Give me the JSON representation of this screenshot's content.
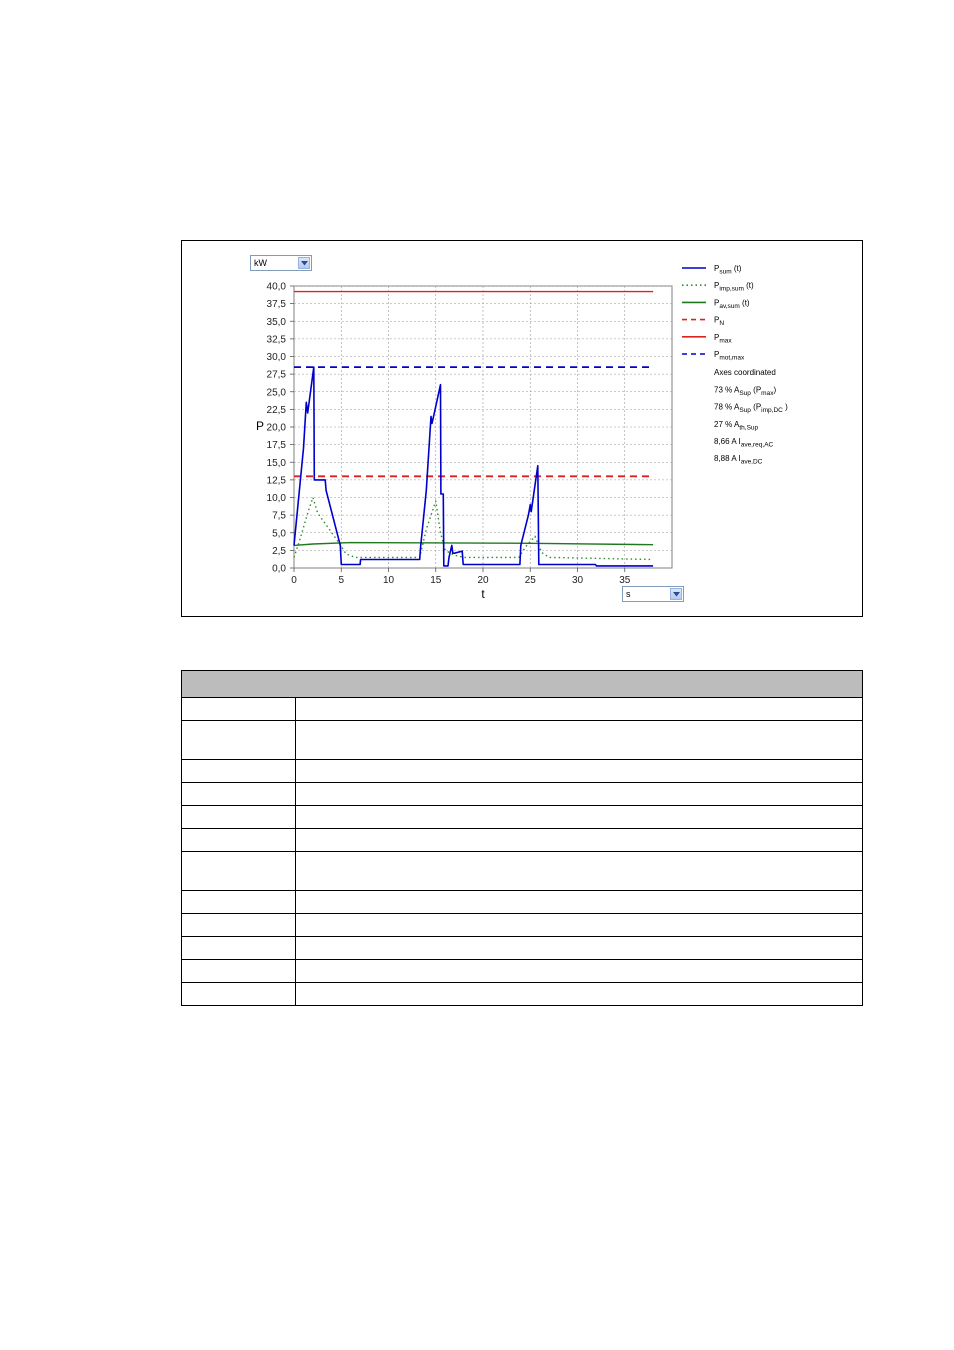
{
  "unit_dropdown": {
    "selected": "kW"
  },
  "time_dropdown": {
    "selected": "s"
  },
  "legend": {
    "series": [
      {
        "main": "P",
        "sub": "sum",
        "suffix": " (t)",
        "color": "#0000cc",
        "dash": "solid"
      },
      {
        "main": "P",
        "sub": "imp,sum",
        "suffix": " (t)",
        "color": "#2e8b2e",
        "dash": "dotted"
      },
      {
        "main": "P",
        "sub": "av,sum",
        "suffix": " (t)",
        "color": "#1f7a1f",
        "dash": "solid"
      },
      {
        "main": "P",
        "sub": "N",
        "suffix": "",
        "color": "#dd2222",
        "dash": "dashed"
      },
      {
        "main": "P",
        "sub": "max",
        "suffix": "",
        "color": "#dd2222",
        "dash": "solid"
      },
      {
        "main": "P",
        "sub": "mot,max",
        "suffix": "",
        "color": "#0000cc",
        "dash": "dashed"
      }
    ],
    "axes_text": "Axes coordinated",
    "info": [
      {
        "pre": "73 %  A",
        "sub": "Sup",
        "post": " (P",
        "sub2": "max",
        "post2": ")"
      },
      {
        "pre": "78 %  A",
        "sub": "Sup",
        "post": " (P",
        "sub2": "imp,DC",
        "post2": " )"
      },
      {
        "pre": "27 %  A",
        "sub": "th,Sup",
        "post": "",
        "sub2": "",
        "post2": ""
      },
      {
        "pre": "8,66 A  I",
        "sub": "ave,req,AC",
        "post": "",
        "sub2": "",
        "post2": ""
      },
      {
        "pre": "8,88 A  I",
        "sub": "ave,DC",
        "post": "",
        "sub2": "",
        "post2": ""
      }
    ]
  },
  "chart_data": {
    "type": "line",
    "xlabel": "t",
    "ylabel": "P",
    "xlim": [
      0,
      40
    ],
    "ylim": [
      0,
      40
    ],
    "x_ticks": [
      0,
      5,
      10,
      15,
      20,
      25,
      30,
      35
    ],
    "x_tick_labels": [
      "0",
      "5",
      "10",
      "15",
      "20",
      "25",
      "30",
      "35"
    ],
    "y_ticks": [
      0,
      2.5,
      5,
      7.5,
      10,
      12.5,
      15,
      17.5,
      20,
      22.5,
      25,
      27.5,
      30,
      32.5,
      35,
      37.5,
      40
    ],
    "y_tick_labels": [
      "0,0",
      "2,5",
      "5,0",
      "7,5",
      "10,0",
      "12,5",
      "15,0",
      "17,5",
      "20,0",
      "22,5",
      "25,0",
      "27,5",
      "30,0",
      "32,5",
      "35,0",
      "37,5",
      "40,0"
    ],
    "grid": true,
    "series": [
      {
        "name": "Psum (t)",
        "color": "#0000cc",
        "dash": "solid",
        "points": [
          [
            0,
            3.2
          ],
          [
            1,
            17
          ],
          [
            1.3,
            23.5
          ],
          [
            1.45,
            22
          ],
          [
            1.6,
            23.5
          ],
          [
            2.1,
            28.5
          ],
          [
            2.15,
            12.5
          ],
          [
            3.3,
            12.5
          ],
          [
            3.4,
            11
          ],
          [
            4.9,
            3.2
          ],
          [
            5,
            0.5
          ],
          [
            7,
            0.5
          ],
          [
            7.05,
            1.2
          ],
          [
            13.3,
            1.2
          ],
          [
            13.4,
            3
          ],
          [
            14,
            11
          ],
          [
            14.5,
            21.5
          ],
          [
            14.6,
            20.5
          ],
          [
            15.5,
            26
          ],
          [
            15.55,
            10.5
          ],
          [
            15.8,
            10.5
          ],
          [
            15.85,
            0.3
          ],
          [
            16.3,
            0.3
          ],
          [
            16.4,
            1.5
          ],
          [
            16.7,
            3.2
          ],
          [
            16.8,
            2.1
          ],
          [
            17,
            2.1
          ],
          [
            17.8,
            2.4
          ],
          [
            17.9,
            0.5
          ],
          [
            23.9,
            0.5
          ],
          [
            24,
            3.2
          ],
          [
            24.8,
            7.5
          ],
          [
            25,
            9
          ],
          [
            25.1,
            8
          ],
          [
            25.8,
            14.5
          ],
          [
            25.9,
            0.5
          ],
          [
            31.9,
            0.5
          ],
          [
            32,
            0.3
          ],
          [
            38,
            0.3
          ]
        ]
      },
      {
        "name": "Pimp,sum (t)",
        "color": "#2e8b2e",
        "dash": "dotted",
        "points": [
          [
            0,
            1.5
          ],
          [
            0.5,
            3.5
          ],
          [
            1.5,
            8
          ],
          [
            2,
            10
          ],
          [
            2.5,
            7.8
          ],
          [
            3.2,
            6.5
          ],
          [
            4,
            5
          ],
          [
            4.8,
            3.5
          ],
          [
            5.5,
            2
          ],
          [
            6.5,
            1.5
          ],
          [
            13.3,
            1.5
          ],
          [
            14,
            5.5
          ],
          [
            15,
            9.5
          ],
          [
            15.5,
            5
          ],
          [
            16,
            2.5
          ],
          [
            17,
            1.8
          ],
          [
            18,
            1.5
          ],
          [
            23.8,
            1.5
          ],
          [
            24.5,
            3
          ],
          [
            25.5,
            4.5
          ],
          [
            26.2,
            2.2
          ],
          [
            27,
            1.5
          ],
          [
            38,
            1.2
          ]
        ]
      },
      {
        "name": "Pav,sum (t)",
        "color": "#1f7a1f",
        "dash": "solid",
        "points": [
          [
            0,
            3.2
          ],
          [
            2,
            3.4
          ],
          [
            6,
            3.6
          ],
          [
            25,
            3.5
          ],
          [
            38,
            3.3
          ]
        ]
      },
      {
        "name": "PN",
        "color": "#dd2222",
        "dash": "dashed",
        "points": [
          [
            0,
            13
          ],
          [
            38,
            13
          ]
        ]
      },
      {
        "name": "Pmax",
        "color": "#dd2222",
        "dash": "solid",
        "points": [
          [
            0,
            39.2
          ],
          [
            38,
            39.2
          ]
        ]
      },
      {
        "name": "Pmot,max",
        "color": "#0000cc",
        "dash": "dashed",
        "points": [
          [
            0,
            28.5
          ],
          [
            38,
            28.5
          ]
        ]
      }
    ]
  },
  "table": {
    "rows": [
      {
        "c1": "",
        "c2": "",
        "tall": false
      },
      {
        "c1": "",
        "c2": "",
        "tall": true
      },
      {
        "c1": "",
        "c2": "",
        "tall": false
      },
      {
        "c1": "",
        "c2": "",
        "tall": false
      },
      {
        "c1": "",
        "c2": "",
        "tall": false
      },
      {
        "c1": "",
        "c2": "",
        "tall": false
      },
      {
        "c1": "",
        "c2": "",
        "tall": true
      },
      {
        "c1": "",
        "c2": "",
        "tall": false
      },
      {
        "c1": "",
        "c2": "",
        "tall": false
      },
      {
        "c1": "",
        "c2": "",
        "tall": false
      },
      {
        "c1": "",
        "c2": "",
        "tall": false
      },
      {
        "c1": "",
        "c2": "",
        "tall": false
      }
    ]
  }
}
